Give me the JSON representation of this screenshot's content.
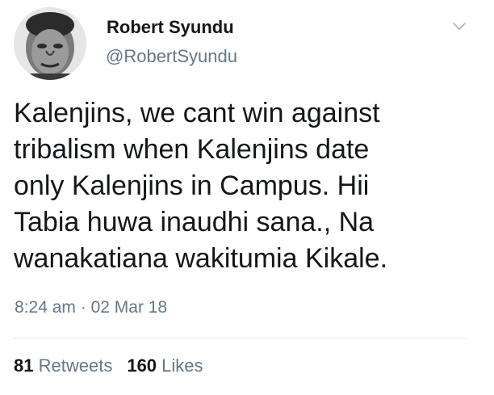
{
  "user": {
    "display_name": "Robert Syundu",
    "handle": "@RobertSyundu",
    "avatar_icon": "profile-photo"
  },
  "tweet": {
    "text": "Kalenjins, we cant win against\ntribalism when Kalenjins date\nonly Kalenjins in Campus. Hii\nTabia huwa inaudhi sana., Na\nwanakatiana wakitumia Kikale.",
    "time": "8:24 am",
    "separator": "·",
    "date": "02 Mar 18"
  },
  "stats": {
    "retweets_count": "81",
    "retweets_label": "Retweets",
    "likes_count": "160",
    "likes_label": "Likes"
  },
  "colors": {
    "text_primary": "#14171a",
    "text_secondary": "#657786",
    "divider": "#e1e8ed"
  },
  "icons": {
    "menu": "chevron-down-icon"
  }
}
